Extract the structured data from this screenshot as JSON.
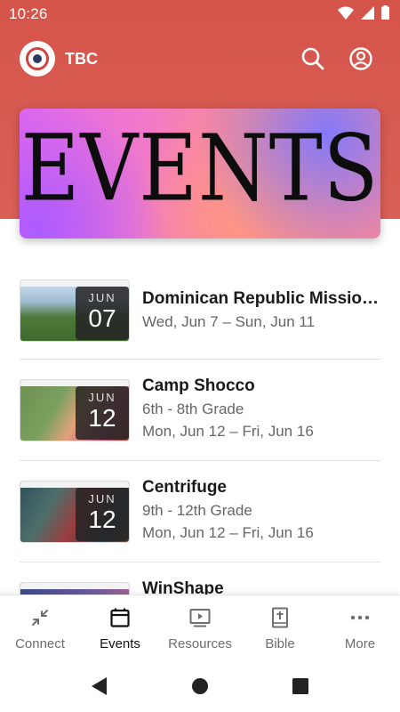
{
  "status_bar": {
    "time": "10:26"
  },
  "app_bar": {
    "title": "TBC",
    "icons": [
      "church-logo",
      "search-icon",
      "account-icon"
    ]
  },
  "hero": {
    "text": "EVENTS"
  },
  "events": [
    {
      "title": "Dominican Republic Missio…",
      "line1": "Wed, Jun 7 – Sun, Jun 11",
      "line2": "",
      "month": "JUN",
      "day": "07"
    },
    {
      "title": "Camp Shocco",
      "line1": "6th - 8th Grade",
      "line2": "Mon, Jun 12 – Fri, Jun 16",
      "month": "JUN",
      "day": "12"
    },
    {
      "title": "Centrifuge",
      "line1": "9th - 12th Grade",
      "line2": "Mon, Jun 12 – Fri, Jun 16",
      "month": "JUN",
      "day": "12"
    },
    {
      "title": "WinShape",
      "line1": "",
      "line2": "",
      "month": "",
      "day": ""
    }
  ],
  "bottom_nav": [
    {
      "label": "Connect",
      "icon": "connect-icon",
      "active": false
    },
    {
      "label": "Events",
      "icon": "calendar-icon",
      "active": true
    },
    {
      "label": "Resources",
      "icon": "video-icon",
      "active": false
    },
    {
      "label": "Bible",
      "icon": "bible-icon",
      "active": false
    },
    {
      "label": "More",
      "icon": "more-icon",
      "active": false
    }
  ],
  "colors": {
    "header": "#d5544a",
    "active_nav": "#111111",
    "inactive_nav": "#6e6e6e"
  }
}
